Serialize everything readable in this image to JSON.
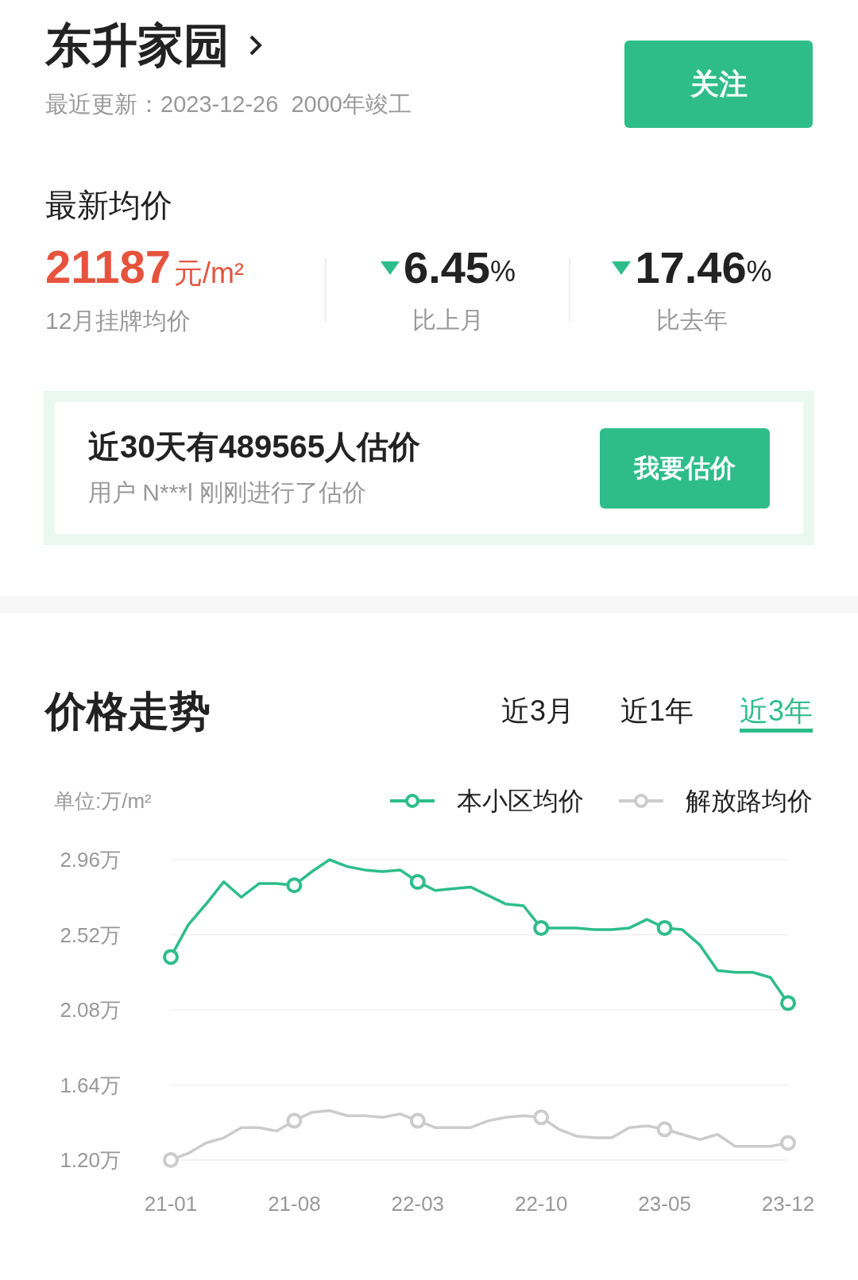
{
  "header": {
    "title": "东升家园",
    "subtitle": "最近更新：2023-12-26  2000年竣工",
    "follow_button": "关注"
  },
  "price": {
    "heading": "最新均价",
    "value": "21187",
    "unit": "元/m²",
    "value_label": "12月挂牌均价",
    "changes": [
      {
        "value": "6.45",
        "unit": "%",
        "label": "比上月",
        "falling": true
      },
      {
        "value": "17.46",
        "unit": "%",
        "label": "比去年",
        "falling": true
      }
    ]
  },
  "estimate": {
    "title": "近30天有489565人估价",
    "subtitle": "用户 N***l 刚刚进行了估价",
    "button": "我要估价"
  },
  "trend": {
    "heading": "价格走势",
    "tabs": [
      {
        "label": "近3月",
        "selected": false
      },
      {
        "label": "近1年",
        "selected": false
      },
      {
        "label": "近3年",
        "selected": true
      }
    ],
    "unit": "单位:万/m²",
    "chart_data": {
      "type": "line",
      "categories": [
        "21-01",
        null,
        null,
        null,
        null,
        null,
        null,
        "21-08",
        null,
        null,
        null,
        null,
        null,
        null,
        "22-03",
        null,
        null,
        null,
        null,
        null,
        null,
        "22-10",
        null,
        null,
        null,
        null,
        null,
        null,
        "23-05",
        null,
        null,
        null,
        null,
        null,
        null,
        "23-12"
      ],
      "yticks": [
        {
          "value": 1.2,
          "label": "1.20万"
        },
        {
          "value": 1.64,
          "label": "1.64万"
        },
        {
          "value": 2.08,
          "label": "2.08万"
        },
        {
          "value": 2.52,
          "label": "2.52万"
        },
        {
          "value": 2.96,
          "label": "2.96万"
        }
      ],
      "ylim": [
        1.2,
        2.96
      ],
      "grid": true,
      "series": [
        {
          "name": "本小区均价",
          "color": "#2ebd8a",
          "values": [
            2.39,
            2.58,
            2.7,
            2.83,
            2.74,
            2.82,
            2.82,
            2.81,
            2.89,
            2.96,
            2.92,
            2.9,
            2.89,
            2.9,
            2.83,
            2.78,
            2.79,
            2.8,
            2.75,
            2.7,
            2.69,
            2.56,
            2.56,
            2.56,
            2.55,
            2.55,
            2.56,
            2.61,
            2.56,
            2.55,
            2.46,
            2.31,
            2.3,
            2.3,
            2.27,
            2.12
          ]
        },
        {
          "name": "解放路均价",
          "color": "#cccccc",
          "values": [
            1.2,
            1.24,
            1.3,
            1.33,
            1.39,
            1.39,
            1.37,
            1.43,
            1.48,
            1.49,
            1.46,
            1.46,
            1.45,
            1.47,
            1.43,
            1.39,
            1.39,
            1.39,
            1.43,
            1.45,
            1.46,
            1.45,
            1.38,
            1.34,
            1.33,
            1.33,
            1.39,
            1.4,
            1.38,
            1.35,
            1.32,
            1.35,
            1.28,
            1.28,
            1.28,
            1.3
          ]
        }
      ]
    }
  }
}
